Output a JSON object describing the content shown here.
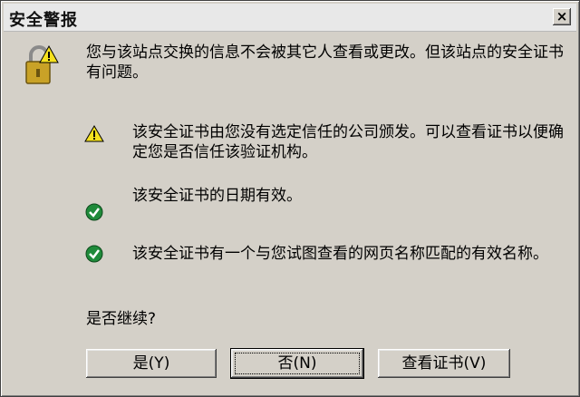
{
  "window": {
    "title": "安全警报",
    "close_glyph": "×"
  },
  "message": "您与该站点交换的信息不会被其它人查看或更改。但该站点的安全证书有问题。",
  "items": [
    {
      "icon": "warning-icon",
      "text": "该安全证书由您没有选定信任的公司颁发。可以查看证书以便确定您是否信任该验证机构。"
    },
    {
      "icon": "check-icon",
      "text": "该安全证书的日期有效。"
    },
    {
      "icon": "check-icon",
      "text": "该安全证书有一个与您试图查看的网页名称匹配的有效名称。"
    }
  ],
  "question": "是否继续?",
  "buttons": {
    "yes": "是(Y)",
    "no": "否(N)",
    "view_cert": "查看证书(V)"
  },
  "colors": {
    "dialog_bg": "#d4d0c8",
    "warning": "#f5e11e",
    "ok": "#1f8a3a",
    "lock": "#c9a227"
  }
}
